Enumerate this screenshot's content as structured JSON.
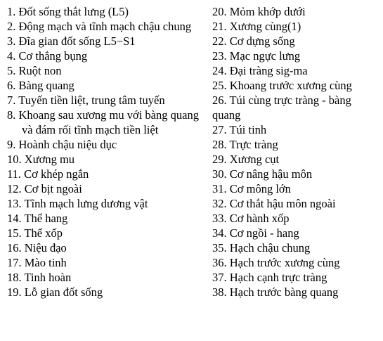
{
  "left_items": [
    "1. Đốt sống thắt lưng (L5)",
    "2. Động mạch và tĩnh mạch chậu chung",
    "3. Đĩa gian đốt sống L5−S1",
    "4. Cơ thẳng bụng",
    "5. Ruột non",
    "6. Bàng quang",
    "7. Tuyến tiền liệt, trung tâm tuyến",
    "8. Khoang sau xương mu với bàng quang và đám rối tĩnh mạch tiền liệt",
    "9. Hoành chậu niệu dục",
    "10. Xương mu",
    "11. Cơ khép ngắn",
    "12. Cơ bịt ngoài",
    "13. Tĩnh mạch lưng dương vật",
    "14. Thể hang",
    "15. Thể xốp",
    "16. Niệu đạo",
    "17. Mào tinh",
    "18. Tinh hoàn",
    "19. Lỗ gian đốt sống"
  ],
  "right_items": [
    "20. Mỏm khớp dưới",
    "21. Xương cùng(1)",
    "22. Cơ dựng sống",
    "23. Mạc ngực lưng",
    "24. Đại tràng sig-ma",
    "25. Khoang trước xương cùng",
    "26. Túi cùng trực tràng - bàng quang",
    "27. Túi tinh",
    "28. Trực tràng",
    "29. Xương cụt",
    "30. Cơ nâng hậu môn",
    "31. Cơ mông lớn",
    "32. Cơ thắt hậu môn ngoài",
    "33. Cơ hành xốp",
    "34. Cơ ngồi - hang",
    "35. Hạch chậu chung",
    "36. Hạch trước xương cùng",
    "37. Hạch cạnh trực tràng",
    "38. Hạch trước bàng quang"
  ]
}
